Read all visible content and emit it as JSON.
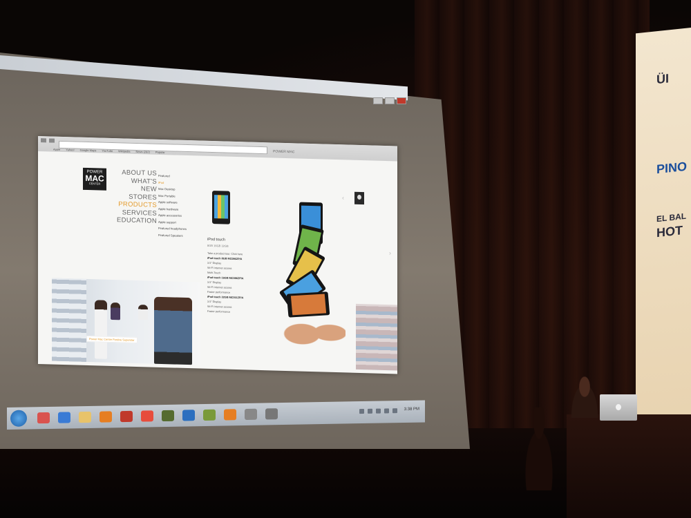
{
  "banner": {
    "line1": "ÜI",
    "line2": "PINO",
    "line3": "EL BAL",
    "line4": "HOT"
  },
  "browser": {
    "bookmarks": [
      "Apple",
      "Yahoo!",
      "Google Maps",
      "YouTube",
      "Wikipedia",
      "News (282)",
      "Popular"
    ],
    "page_title": "POWER MAC"
  },
  "logo": {
    "line1": "POWER",
    "line2": "MAC",
    "line3": "CENTER"
  },
  "nav": {
    "items": [
      "ABOUT US",
      "WHAT'S NEW",
      "STORES",
      "PRODUCTS",
      "SERVICES",
      "EDUCATION"
    ],
    "active_index": 3
  },
  "submenu": {
    "items": [
      "Featured",
      "iPod",
      "Mac Desktop",
      "Mac Portable",
      "Apple software",
      "Apple hardware",
      "Apple accessories",
      "Apple support",
      "Featured headphones",
      "Featured Speakers"
    ],
    "highlight_index": 1
  },
  "product": {
    "name": "iPod touch",
    "subtitle": "8GB 16GB 32GB",
    "lines": [
      {
        "text": "Take a product tour. Click here",
        "head": false
      },
      {
        "text": "iPod touch 8GB MC086ZP/A",
        "head": true
      },
      {
        "text": "3.5\" Display",
        "head": false
      },
      {
        "text": "Wi-Fi internet access",
        "head": false
      },
      {
        "text": "Multi-Touch",
        "head": false
      },
      {
        "text": "iPod touch 16GB MC086ZP/A",
        "head": true
      },
      {
        "text": "3.5\" Display",
        "head": false
      },
      {
        "text": "Wi-Fi internet access",
        "head": false
      },
      {
        "text": "Faster performance",
        "head": false
      },
      {
        "text": "iPod touch 32GB MC011ZP/A",
        "head": true
      },
      {
        "text": "3.5\" Display",
        "head": false
      },
      {
        "text": "Wi-Fi internet access",
        "head": false
      },
      {
        "text": "Faster performance",
        "head": false
      }
    ]
  },
  "caption": "Power Mac Center Festive Superstar",
  "taskbar": {
    "clock": "3:38 PM"
  },
  "colors": {
    "accent": "#e49b2c",
    "screen": "#837a6f",
    "taskbar": "#aab2bb"
  }
}
